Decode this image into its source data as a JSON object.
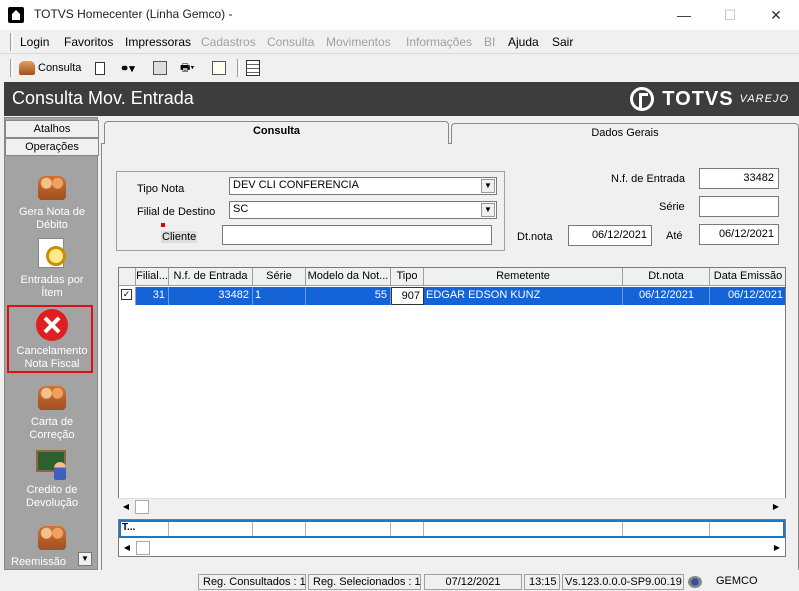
{
  "window": {
    "title": "TOTVS Homecenter (Linha Gemco) -",
    "minimize": "—",
    "maximize": "☐",
    "close": "✕"
  },
  "menu": {
    "items": [
      {
        "label": "Login",
        "enabled": true
      },
      {
        "label": "Favoritos",
        "enabled": true
      },
      {
        "label": "Impressoras",
        "enabled": true
      },
      {
        "label": "Cadastros",
        "enabled": false
      },
      {
        "label": "Consulta",
        "enabled": false
      },
      {
        "label": "Movimentos",
        "enabled": false
      },
      {
        "label": "Informações",
        "enabled": false
      },
      {
        "label": "BI",
        "enabled": false
      },
      {
        "label": "Ajuda",
        "enabled": true
      },
      {
        "label": "Sair",
        "enabled": true
      }
    ]
  },
  "toolbar": {
    "consulta_label": "Consulta"
  },
  "header": {
    "title": "Consulta Mov. Entrada",
    "logo_text": "TOTVS",
    "logo_sub": "VAREJO"
  },
  "sidebar": {
    "tabs": [
      "Atalhos",
      "Operações"
    ],
    "items": [
      {
        "label": "Gera Nota de Débito",
        "icon": "people-icon"
      },
      {
        "label": "Entradas por Ítem",
        "icon": "search-icon"
      },
      {
        "label": "Cancelamento Nota Fiscal",
        "icon": "cancel-icon"
      },
      {
        "label": "Carta de Correção",
        "icon": "people-icon"
      },
      {
        "label": "Credito de Devolução",
        "icon": "board-icon"
      },
      {
        "label": "Reemissão",
        "icon": "people-icon"
      }
    ]
  },
  "tabs": {
    "consulta": "Consulta",
    "dados_gerais": "Dados Gerais"
  },
  "filters": {
    "tipo_nota_label": "Tipo Nota",
    "tipo_nota_value": "DEV CLI CONFERENCIA",
    "filial_label": "Filial de Destino",
    "filial_value": "SC",
    "cliente_label": "Cliente",
    "cliente_value": "",
    "nf_label": "N.f. de Entrada",
    "nf_value": "33482",
    "serie_label": "Série",
    "serie_value": "",
    "dtnota_label": "Dt.nota",
    "dtnota_from": "06/12/2021",
    "ate_label": "Até",
    "dtnota_to": "06/12/2021"
  },
  "grid": {
    "headers": [
      "Filial...",
      "N.f. de Entrada",
      "Série",
      "Modelo da Not...",
      "Tipo",
      "Remetente",
      "Dt.nota",
      "Data Emissão"
    ],
    "rows": [
      {
        "check": "✓",
        "filial": "31",
        "nf": "33482",
        "serie": "1",
        "modelo": "55",
        "tipo": "907",
        "remetente": "EDGAR EDSON KUNZ",
        "dtnota": "06/12/2021",
        "emissao": "06/12/2021"
      }
    ],
    "totals_label": "T..."
  },
  "status": {
    "consultados": "Reg. Consultados : 1",
    "selecionados": "Reg. Selecionados : 1",
    "date": "07/12/2021",
    "time": "13:15",
    "version": "Vs.123.0.0.0-SP9.00.19",
    "user": "GEMCO"
  }
}
